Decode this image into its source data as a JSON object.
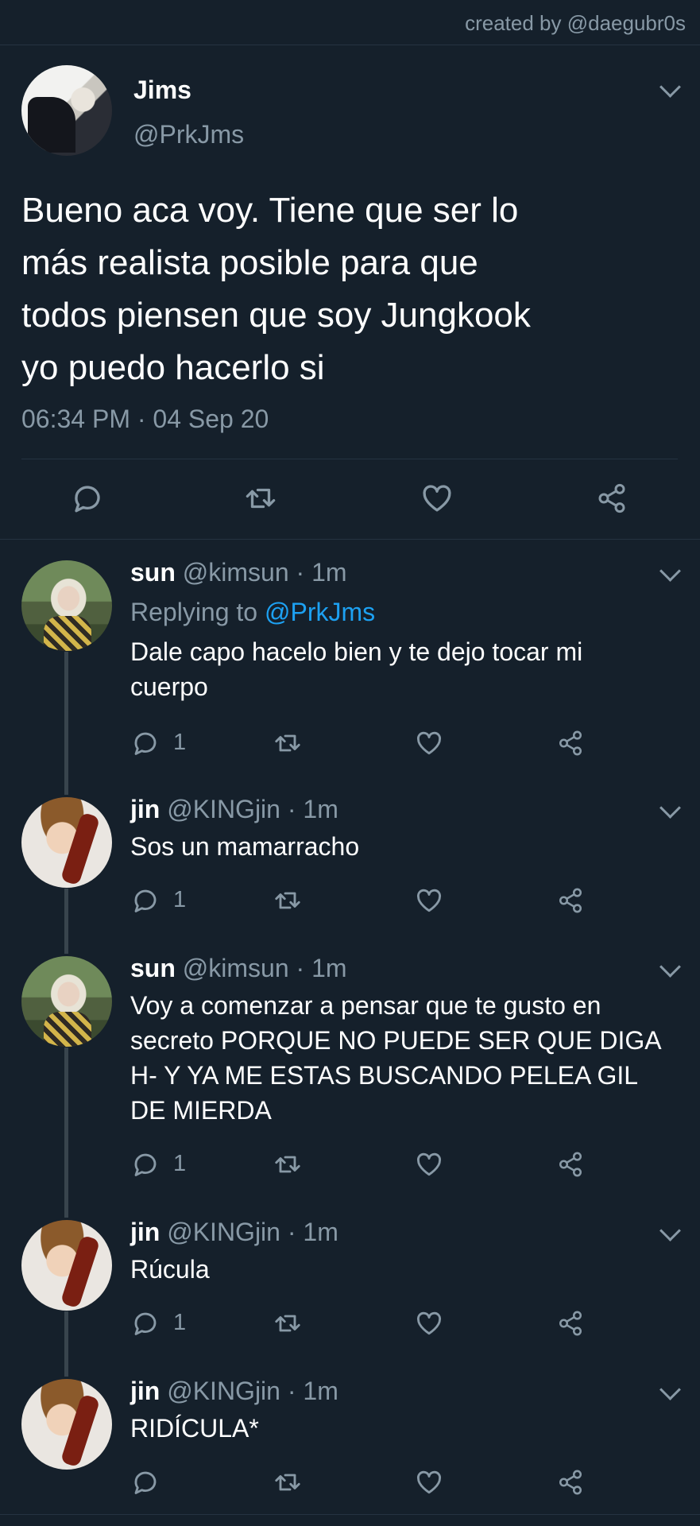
{
  "credit": "created by @daegubr0s",
  "main_tweet": {
    "name": "Jims",
    "handle": "@PrkJms",
    "text": "Bueno aca voy. Tiene que ser lo\nmás realista posible para que\ntodos piensen que soy Jungkook\nyo puedo hacerlo si",
    "timestamp": "06:34 PM · 04 Sep 20"
  },
  "replies": [
    {
      "name": "sun",
      "handle": "@kimsun",
      "dot": "·",
      "time": "1m",
      "replying_prefix": "Replying to",
      "replying_to": "@PrkJms",
      "text": "Dale capo hacelo bien y te dejo tocar mi\ncuerpo",
      "reply_count": "1"
    },
    {
      "name": "jin",
      "handle": "@KINGjin",
      "dot": "·",
      "time": "1m",
      "text": "Sos un mamarracho",
      "reply_count": "1"
    },
    {
      "name": "sun",
      "handle": "@kimsun",
      "dot": "·",
      "time": "1m",
      "text": "Voy a comenzar a pensar que te gusto en\nsecreto PORQUE NO PUEDE SER QUE DIGA\nH- Y YA ME ESTAS BUSCANDO PELEA GIL\nDE MIERDA",
      "reply_count": "1"
    },
    {
      "name": "jin",
      "handle": "@KINGjin",
      "dot": "·",
      "time": "1m",
      "text": "Rúcula",
      "reply_count": "1"
    },
    {
      "name": "jin",
      "handle": "@KINGjin",
      "dot": "·",
      "time": "1m",
      "text": "RIDÍCULA*"
    }
  ],
  "icons": {
    "reply": "comment-bubble-icon",
    "retweet": "retweet-icon",
    "like": "heart-icon",
    "share": "share-icon",
    "menu": "chevron-down-icon"
  },
  "colors": {
    "background": "#15202b",
    "secondary_text": "#8899a6",
    "mention": "#1da1f2",
    "divider": "#253341",
    "thread_line": "#38444d"
  }
}
